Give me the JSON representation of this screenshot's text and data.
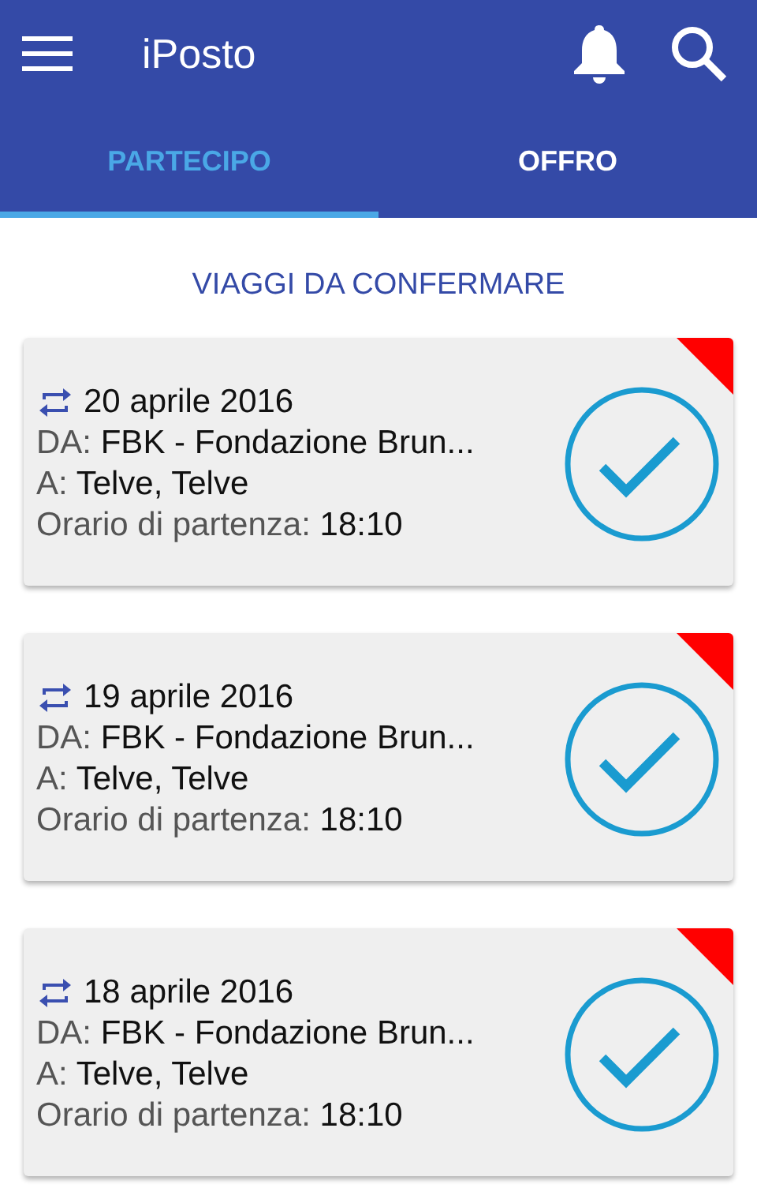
{
  "app_bar": {
    "title": "iPosto"
  },
  "tabs": [
    {
      "label": "PARTECIPO",
      "selected": true
    },
    {
      "label": "OFFRO",
      "selected": false
    }
  ],
  "section_title": "VIAGGI DA CONFERMARE",
  "trips": [
    {
      "date": "20 aprile 2016",
      "flagged": true,
      "fields": [
        {
          "label": "DA:",
          "value": "FBK - Fondazione Brun..."
        },
        {
          "label": "A:",
          "value": "Telve, Telve"
        },
        {
          "label": "Orario di partenza:",
          "value": "18:10"
        }
      ]
    },
    {
      "date": "19 aprile 2016",
      "flagged": true,
      "fields": [
        {
          "label": "DA:",
          "value": "FBK - Fondazione Brun..."
        },
        {
          "label": "A:",
          "value": "Telve, Telve"
        },
        {
          "label": "Orario di partenza:",
          "value": "18:10"
        }
      ]
    },
    {
      "date": "18 aprile 2016",
      "flagged": true,
      "fields": [
        {
          "label": "DA:",
          "value": "FBK - Fondazione Brun..."
        },
        {
          "label": "A:",
          "value": "Telve, Telve"
        },
        {
          "label": "Orario di partenza:",
          "value": "18:10"
        }
      ]
    }
  ]
}
